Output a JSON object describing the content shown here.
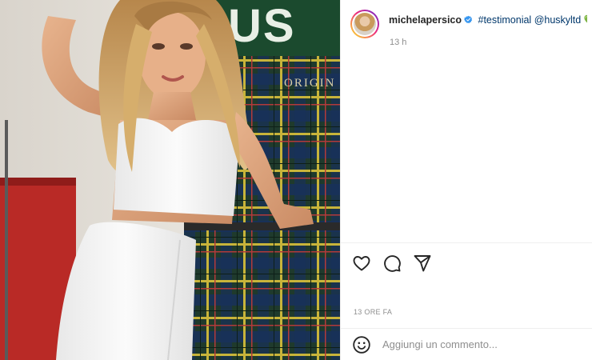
{
  "post": {
    "author": {
      "username": "michelapersico",
      "verified": true,
      "verified_icon": "verified-badge-icon",
      "avatar": "profile-avatar"
    },
    "caption": {
      "hashtag": "#testimonial",
      "mention": "@huskyltd",
      "emoji": "💚"
    },
    "time_ago": "13 h",
    "date_label": "13 ORE FA"
  },
  "photo": {
    "alt": "Woman in white crop top and white trousers leaning against a tartan wall with a green sign",
    "sign_text": "ORIGIN"
  },
  "actions": {
    "like_icon": "heart-icon",
    "comment_icon": "comment-bubble-icon",
    "share_icon": "paper-plane-icon"
  },
  "comment": {
    "emoji_icon": "smiley-icon",
    "placeholder": "Aggiungi un commento..."
  },
  "colors": {
    "link": "#00376b",
    "muted": "#8e8e8e",
    "text": "#262626",
    "verified": "#3897f0"
  }
}
